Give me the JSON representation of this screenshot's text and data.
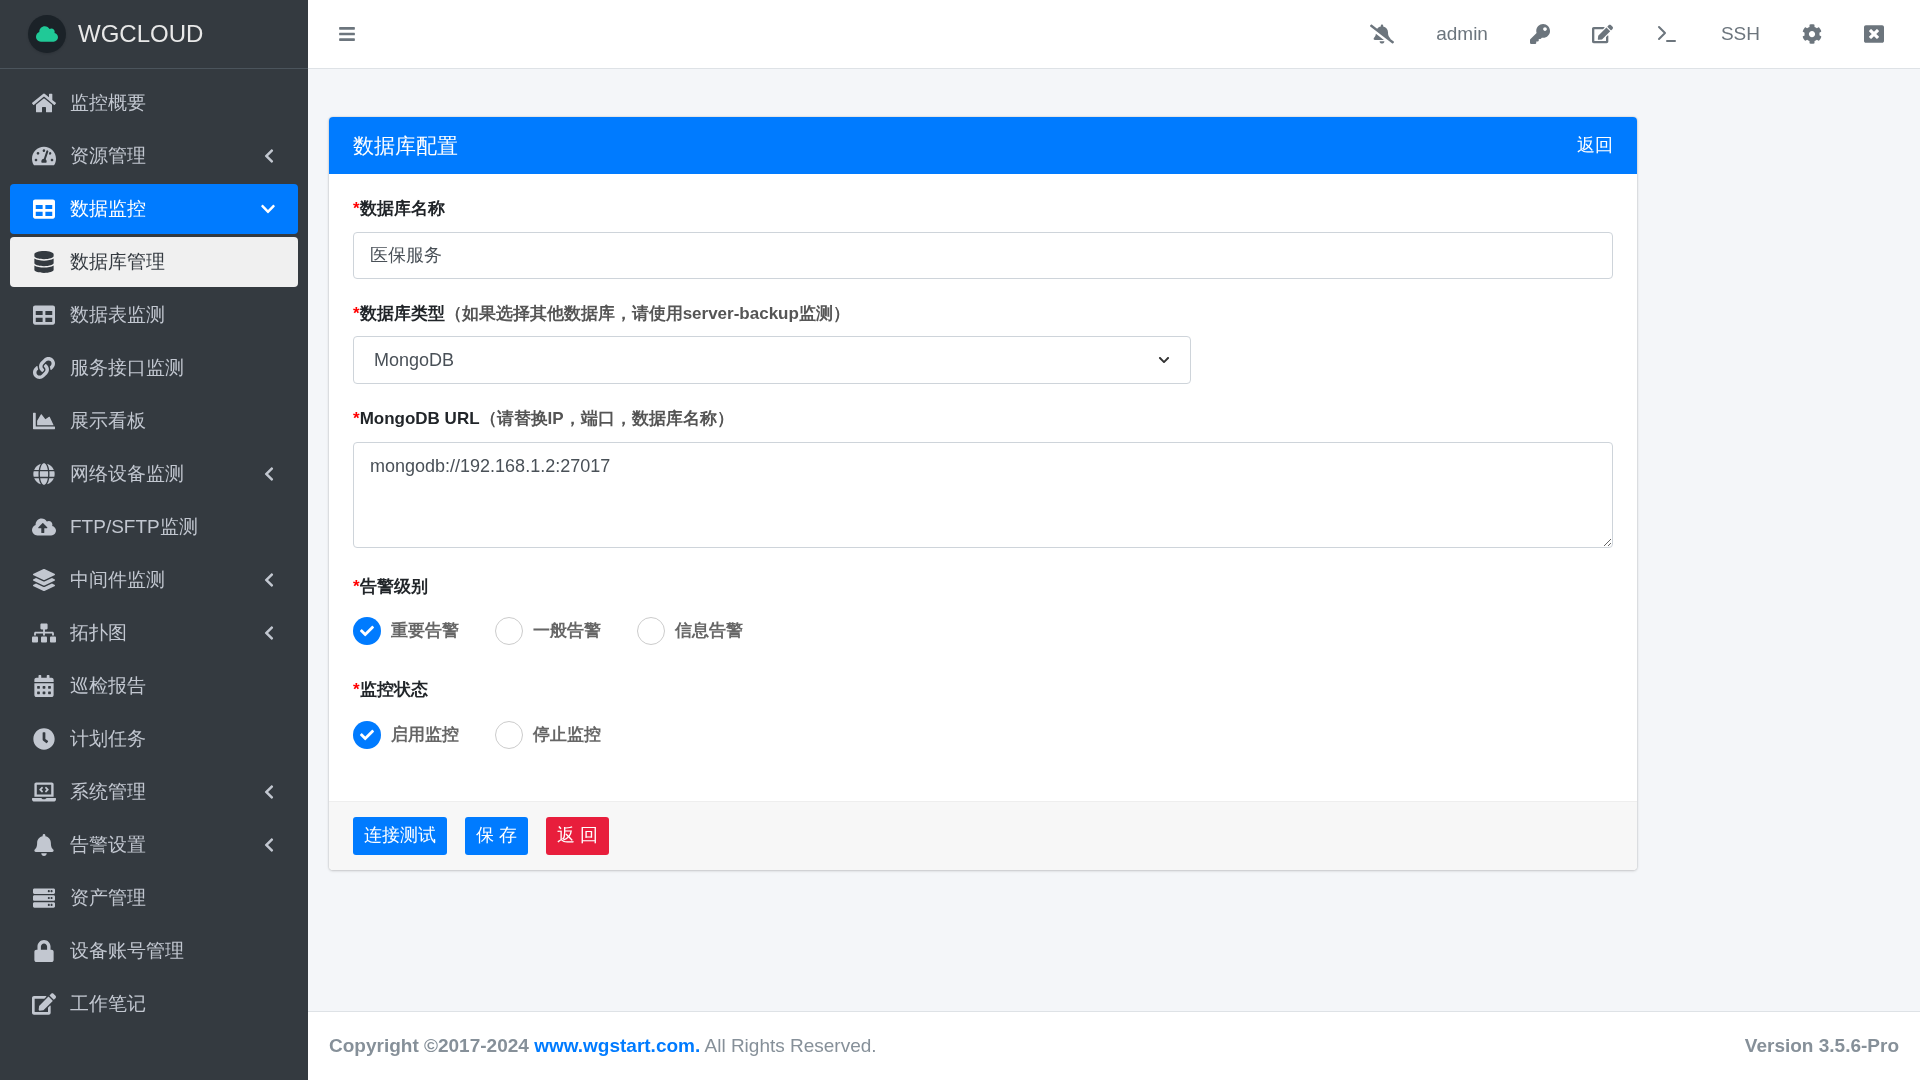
{
  "brand": {
    "name": "WGCLOUD"
  },
  "sidebar": {
    "items": [
      {
        "label": "监控概要",
        "selected": false
      },
      {
        "label": "资源管理",
        "selected": false,
        "expanded": false
      },
      {
        "label": "数据监控",
        "selected": true,
        "expanded": true,
        "children": [
          {
            "label": "数据库管理",
            "selected": true
          },
          {
            "label": "数据表监测",
            "selected": false
          },
          {
            "label": "服务接口监测",
            "selected": false
          },
          {
            "label": "展示看板",
            "selected": false
          }
        ]
      },
      {
        "label": "网络设备监测",
        "selected": false,
        "expanded": false
      },
      {
        "label": "FTP/SFTP监测",
        "selected": false
      },
      {
        "label": "中间件监测",
        "selected": false,
        "expanded": false
      },
      {
        "label": "拓扑图",
        "selected": false,
        "expanded": false
      },
      {
        "label": "巡检报告",
        "selected": false
      },
      {
        "label": "计划任务",
        "selected": false
      },
      {
        "label": "系统管理",
        "selected": false,
        "expanded": false
      },
      {
        "label": "告警设置",
        "selected": false,
        "expanded": false
      },
      {
        "label": "资产管理",
        "selected": false
      },
      {
        "label": "设备账号管理",
        "selected": false
      },
      {
        "label": "工作笔记",
        "selected": false
      }
    ]
  },
  "topbar": {
    "user": "admin",
    "ssh": "SSH"
  },
  "card": {
    "title": "数据库配置",
    "back_link": "返回",
    "required_mark": "*",
    "fields": [
      {
        "kind": "input",
        "label": "数据库名称",
        "value": "医保服务"
      },
      {
        "kind": "select",
        "label": "数据库类型",
        "hint": "（如果选择其他数据库，请使用server-backup监测）",
        "value": "MongoDB"
      },
      {
        "kind": "textarea",
        "label": "MongoDB URL",
        "hint": "（请替换IP，端口，数据库名称）",
        "value": "mongodb://192.168.1.2:27017"
      },
      {
        "kind": "radio",
        "label": "告警级别",
        "options": [
          {
            "label": "重要告警",
            "selected": true
          },
          {
            "label": "一般告警",
            "selected": false
          },
          {
            "label": "信息告警",
            "selected": false
          }
        ]
      },
      {
        "kind": "radio",
        "label": "监控状态",
        "options": [
          {
            "label": "启用监控",
            "selected": true
          },
          {
            "label": "停止监控",
            "selected": false
          }
        ]
      }
    ],
    "buttons": [
      {
        "label": "连接测试",
        "kind": "primary"
      },
      {
        "label": "保 存",
        "kind": "primary"
      },
      {
        "label": "返 回",
        "kind": "danger"
      }
    ]
  },
  "footer": {
    "copyright": "Copyright ©2017-2024",
    "link": "www.wgstart.com.",
    "rights": "All Rights Reserved.",
    "version": "Version 3.5.6-Pro"
  }
}
